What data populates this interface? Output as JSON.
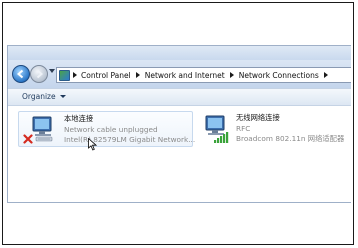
{
  "nav": {
    "breadcrumbs": [
      "Control Panel",
      "Network and Internet",
      "Network Connections"
    ]
  },
  "toolbar": {
    "organize_label": "Organize"
  },
  "connections": [
    {
      "name": "本地连接",
      "status": "Network cable unplugged",
      "device": "Intel(R) 82579LM Gigabit Network..."
    },
    {
      "name": "无线网络连接",
      "status": "RFC",
      "device": "Broadcom 802.11n 网络适配器"
    }
  ],
  "icons": {
    "back": "back-arrow-icon",
    "forward": "forward-arrow-icon",
    "control_panel": "control-panel-icon",
    "wired": "wired-network-adapter-icon",
    "wireless": "wireless-network-adapter-icon",
    "disconnected": "red-x-icon",
    "cursor": "mouse-pointer-icon"
  },
  "colors": {
    "accent": "#2c78c8",
    "toolbar_text": "#1e395b",
    "disconnected_red": "#d42a1f",
    "signal_green": "#3aa33a"
  }
}
